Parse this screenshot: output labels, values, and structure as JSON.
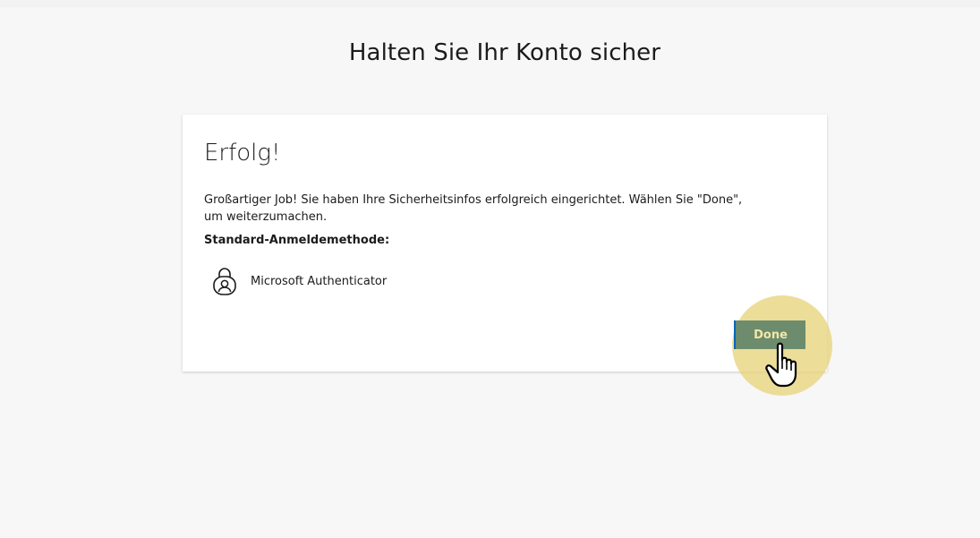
{
  "header": {
    "title": "Halten Sie Ihr Konto sicher"
  },
  "card": {
    "heading": "Erfolg!",
    "message": "Großartiger Job! Sie haben Ihre Sicherheitsinfos erfolgreich eingerichtet. Wählen Sie \"Done\", um weiterzumachen.",
    "default_method_label": "Standard-Anmeldemethode:",
    "method": {
      "icon": "authenticator-lock-icon",
      "name": "Microsoft Authenticator"
    },
    "done_button_label": "Done"
  },
  "overlay": {
    "pointer_icon": "hand-pointer-icon",
    "highlight_color": "#e8d582"
  },
  "colors": {
    "page_background": "#f7f7f7",
    "button_background": "#6d8c6d",
    "button_text": "#f3e7a6",
    "accent": "#0067b8"
  }
}
